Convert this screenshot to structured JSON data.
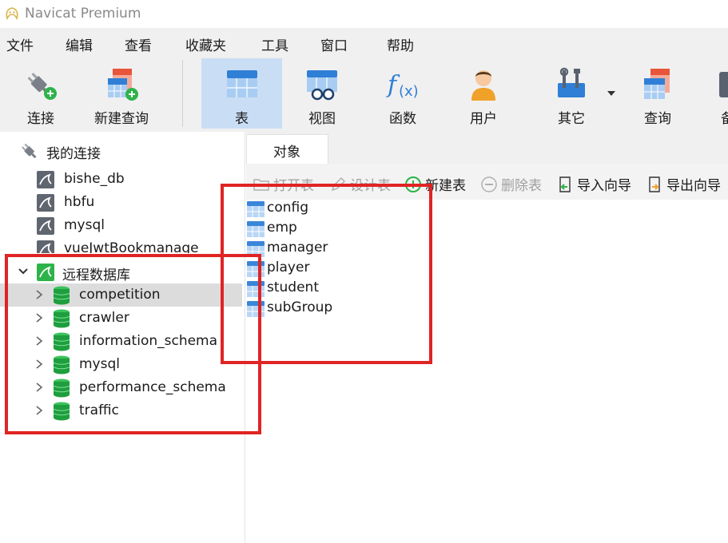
{
  "window": {
    "title": "Navicat Premium"
  },
  "menu": [
    "文件",
    "编辑",
    "查看",
    "收藏夹",
    "工具",
    "窗口",
    "帮助"
  ],
  "toolbar": {
    "items": [
      {
        "label": "连接",
        "icon": "plug-icon"
      },
      {
        "label": "新建查询",
        "icon": "new-query-icon"
      },
      {
        "label": "表",
        "icon": "table-icon",
        "active": true
      },
      {
        "label": "视图",
        "icon": "view-icon"
      },
      {
        "label": "函数",
        "icon": "function-icon"
      },
      {
        "label": "用户",
        "icon": "user-icon"
      },
      {
        "label": "其它",
        "icon": "tools-icon"
      },
      {
        "label": "查询",
        "icon": "query-icon"
      },
      {
        "label": "备",
        "icon": "backup-icon"
      }
    ]
  },
  "sidebar": {
    "root_label": "我的连接",
    "connections": [
      "bishe_db",
      "hbfu",
      "mysql",
      "vueJwtBookmanage"
    ],
    "remote": {
      "label": "远程数据库",
      "databases": [
        {
          "name": "competition",
          "selected": true
        },
        {
          "name": "crawler"
        },
        {
          "name": "information_schema"
        },
        {
          "name": "mysql"
        },
        {
          "name": "performance_schema"
        },
        {
          "name": "traffic"
        }
      ]
    }
  },
  "tabs": {
    "objects": "对象"
  },
  "object_toolbar": {
    "open_table": "打开表",
    "design_table": "设计表",
    "new_table": "新建表",
    "delete_table": "删除表",
    "import_wizard": "导入向导",
    "export_wizard": "导出向导"
  },
  "tables": [
    "config",
    "emp",
    "manager",
    "player",
    "student",
    "subGroup"
  ],
  "colors": {
    "annotation": "#e02424",
    "active_tool_bg": "#c9def5",
    "db_green": "#1f9e3e",
    "table_blue": "#3a86d8"
  }
}
